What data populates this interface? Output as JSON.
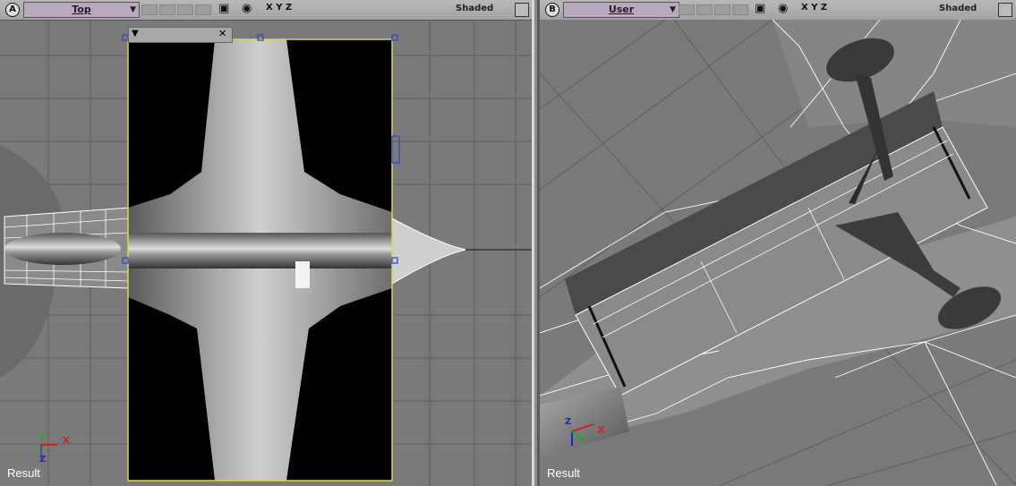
{
  "viewport_a": {
    "letter": "A",
    "view_name": "Top",
    "axis_labels": "X Y Z",
    "shading": "Shaded",
    "result_label": "Result",
    "gizmo_x": "X",
    "gizmo_y": "Y",
    "gizmo_z": "Z"
  },
  "viewport_b": {
    "letter": "B",
    "view_name": "User",
    "axis_labels": "X Y Z",
    "shading": "Shaded",
    "result_label": "Result",
    "gizmo_x": "X",
    "gizmo_y": "Y",
    "gizmo_z": "Z"
  },
  "floating_panel": {
    "menu_icon": "triangle-down-icon",
    "close_icon": "close-icon"
  },
  "colors": {
    "viewport_bg": "#7a7a7a",
    "grid": "#5e5e5e",
    "selection": "#d8d84a",
    "handle": "#2f43c8",
    "wire": "#ffffff",
    "view_selector": "#b9a8bf"
  }
}
